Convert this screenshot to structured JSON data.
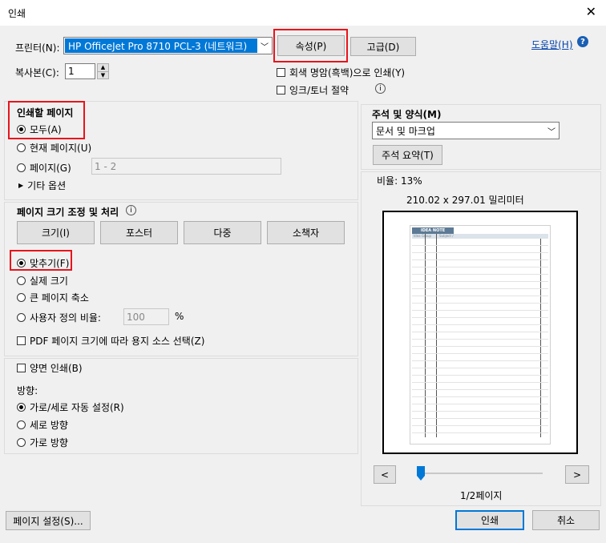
{
  "window": {
    "title": "인쇄",
    "close_glyph": "✕"
  },
  "printer": {
    "label": "프린터(N):",
    "selected": "HP OfficeJet Pro 8710 PCL-3 (네트워크)",
    "properties_button": "속성(P)",
    "advanced_button": "고급(D)",
    "help_link": "도움말(H)",
    "help_icon": "?"
  },
  "copies": {
    "label": "복사본(C):",
    "value": "1"
  },
  "options": {
    "grayscale": "회색 명암(흑백)으로 인쇄(Y)",
    "save_ink": "잉크/토너 절약",
    "info_icon": "i"
  },
  "pages_to_print": {
    "title": "인쇄할 페이지",
    "all": "모두(A)",
    "current": "현재 페이지(U)",
    "pages": "페이지(G)",
    "pages_value": "1 - 2",
    "more_options": "기타 옵션"
  },
  "page_sizing": {
    "title": "페이지 크기 조정 및 처리",
    "info_icon": "i",
    "tabs": [
      "크기(I)",
      "포스터",
      "다중",
      "소책자"
    ],
    "fit": "맞추기(F)",
    "actual": "실제 크기",
    "shrink": "큰 페이지 축소",
    "custom": "사용자 정의 비율:",
    "custom_value": "100",
    "percent": "%",
    "pdf_source": "PDF 페이지 크기에 따라 용지 소스 선택(Z)"
  },
  "duplex": {
    "label": "양면 인쇄(B)"
  },
  "orientation": {
    "title": "방향:",
    "auto": "가로/세로 자동 설정(R)",
    "portrait": "세로 방향",
    "landscape": "가로 방향"
  },
  "comments": {
    "title": "주석 및 양식(M)",
    "selected": "문서 및 마크업",
    "summary_button": "주석 요약(T)"
  },
  "preview": {
    "scale": "비율: 13%",
    "size": "210.02 x 297.01 밀리미터",
    "doc_title": "IDEA NOTE",
    "doc_col1": "Idea Group",
    "doc_col2": "Subject /",
    "page_label": "1/2페이지",
    "page_fraction": 0.5,
    "prev": "<",
    "next": ">"
  },
  "footer": {
    "page_setup": "페이지 설정(S)...",
    "print": "인쇄",
    "cancel": "취소"
  }
}
